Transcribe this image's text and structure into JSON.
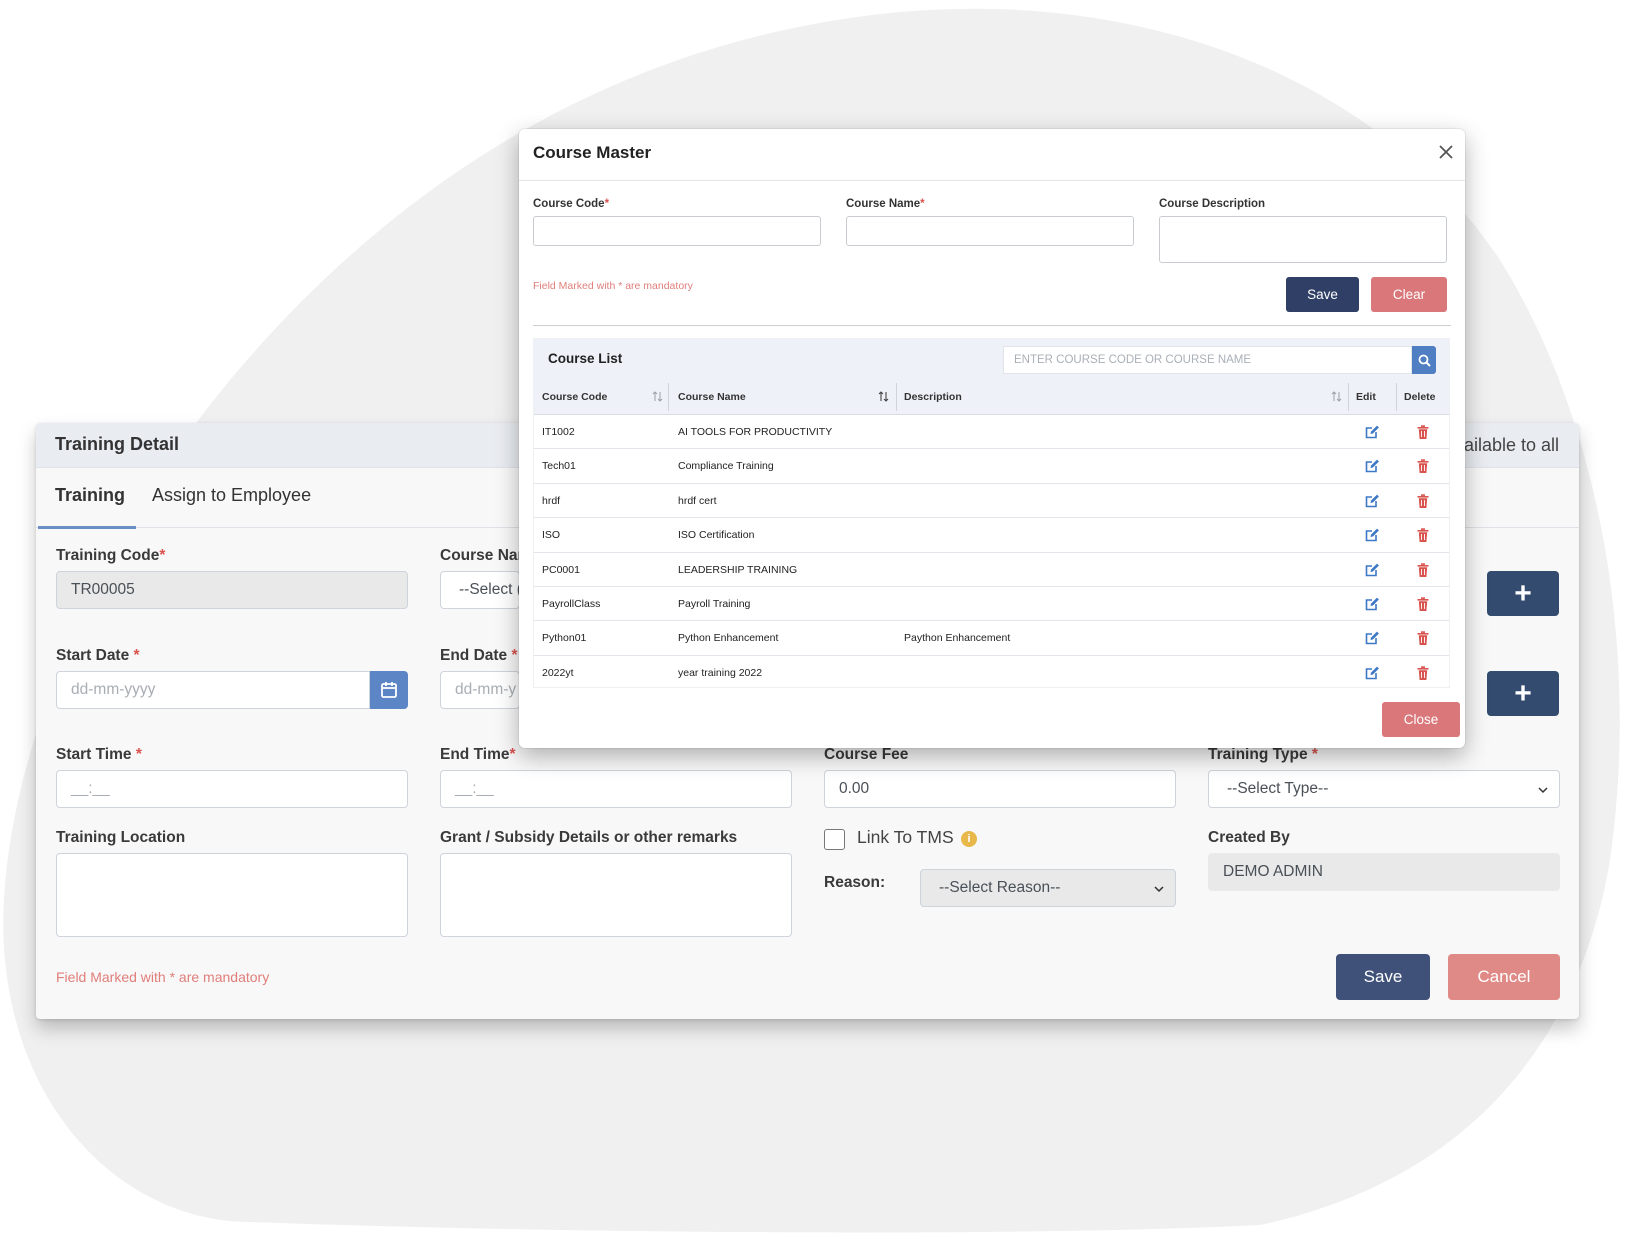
{
  "training_detail": {
    "title": "Training Detail",
    "right_text": "ailable to all",
    "tabs": [
      "Training",
      "Assign to Employee"
    ],
    "fields": {
      "training_code": {
        "label": "Training Code",
        "value": "TR00005"
      },
      "course_name": {
        "label": "Course Nar",
        "value": "--Select ("
      },
      "start_date": {
        "label": "Start Date ",
        "placeholder": "dd-mm-yyyy"
      },
      "end_date": {
        "label": "End Date ",
        "placeholder": "dd-mm-y"
      },
      "start_time": {
        "label": "Start Time ",
        "value": "__:__"
      },
      "end_time": {
        "label": "End Time",
        "value": "__:__"
      },
      "course_fee": {
        "label": "Course Fee",
        "value": "0.00"
      },
      "training_type": {
        "label": "Training Type ",
        "value": "--Select Type--"
      },
      "training_location": {
        "label": "Training Location"
      },
      "grant_details": {
        "label": "Grant / Subsidy Details or other remarks"
      },
      "link_to_tms": {
        "label": "Link To TMS",
        "info": "i"
      },
      "reason": {
        "label": "Reason:",
        "value": "--Select Reason--"
      },
      "created_by": {
        "label": "Created By",
        "value": "DEMO ADMIN"
      }
    },
    "required_marker": "*",
    "add_button_label": "+",
    "mandatory_note": "Field Marked with * are mandatory",
    "save_label": "Save",
    "cancel_label": "Cancel"
  },
  "course_master": {
    "title": "Course Master",
    "fields": {
      "course_code_label": "Course Code",
      "course_name_label": "Course Name",
      "course_description_label": "Course Description"
    },
    "mandatory_note": "Field Marked with * are mandatory",
    "save_label": "Save",
    "clear_label": "Clear",
    "close_label": "Close",
    "course_list": {
      "title": "Course List",
      "search_placeholder": "ENTER COURSE CODE OR COURSE NAME",
      "columns": [
        "Course Code",
        "Course Name",
        "Description",
        "Edit",
        "Delete"
      ],
      "rows": [
        {
          "code": "IT1002",
          "name": "AI TOOLS FOR PRODUCTIVITY",
          "description": ""
        },
        {
          "code": "Tech01",
          "name": "Compliance Training",
          "description": ""
        },
        {
          "code": "hrdf",
          "name": "hrdf cert",
          "description": ""
        },
        {
          "code": "ISO",
          "name": "ISO Certification",
          "description": ""
        },
        {
          "code": "PC0001",
          "name": "LEADERSHIP TRAINING",
          "description": ""
        },
        {
          "code": "PayrollClass",
          "name": "Payroll Training",
          "description": ""
        },
        {
          "code": "Python01",
          "name": "Python Enhancement",
          "description": "Paython Enhancement"
        },
        {
          "code": "2022yt",
          "name": "year training 2022",
          "description": ""
        }
      ]
    }
  },
  "colors": {
    "primary_navy": "#2f3f66",
    "danger_soft": "#d9777a",
    "accent_blue": "#4f7fc2",
    "required_red": "#d9534f",
    "info_yellow": "#e8b84a"
  },
  "icons": [
    "calendar-icon",
    "chevron-down-icon",
    "plus-icon",
    "close-icon",
    "search-icon",
    "sort-icon",
    "edit-icon",
    "trash-icon",
    "info-icon"
  ]
}
